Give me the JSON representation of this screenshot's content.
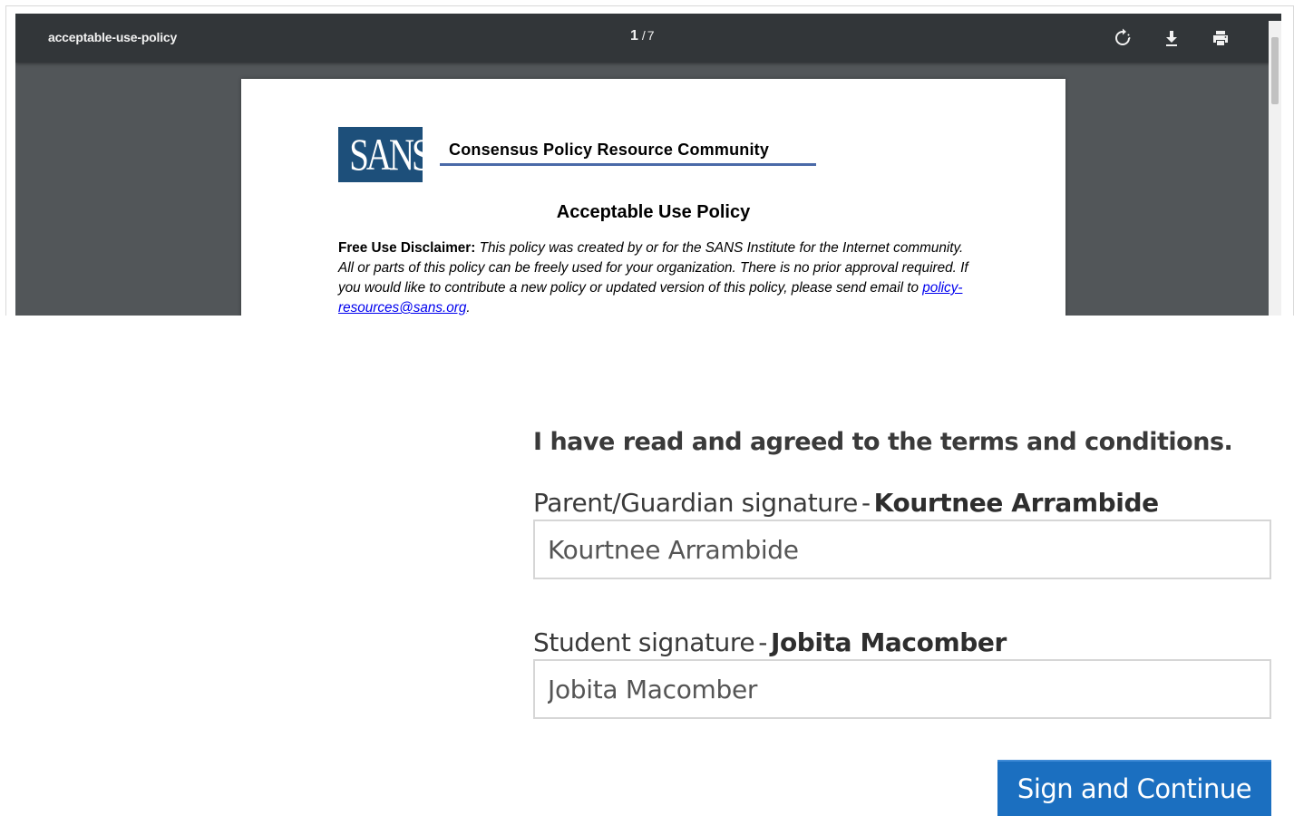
{
  "pdf_viewer": {
    "title": "acceptable-use-policy",
    "current_page": "1",
    "page_separator": "/",
    "total_pages": "7",
    "icons": {
      "rotate": "rotate-icon",
      "download": "download-icon",
      "print": "print-icon"
    },
    "colors": {
      "toolbar": "#323639",
      "background": "#525659"
    }
  },
  "document": {
    "logo_text": "SANS",
    "community_title": "Consensus Policy Resource Community",
    "title": "Acceptable Use Policy",
    "disclaimer_label": "Free Use Disclaimer:",
    "disclaimer_text": " This policy was created by or for the SANS Institute for the Internet community. All or parts of this policy can be freely used for your organization. There is no prior approval required. If you would like to contribute a new policy or updated version of this policy, please send email to ",
    "disclaimer_email": "policy-resources@sans.org",
    "disclaimer_end": "."
  },
  "form": {
    "agreement_text": "I have read and agreed to the terms and conditions.",
    "parent_label": "Parent/Guardian signature",
    "parent_name": "Kourtnee Arrambide",
    "parent_value": "Kourtnee Arrambide",
    "student_label": "Student signature",
    "student_name": "Jobita Macomber",
    "student_value": "Jobita Macomber",
    "label_separator": "-",
    "submit_label": "Sign and Continue",
    "colors": {
      "button": "#1b6fc0"
    }
  }
}
